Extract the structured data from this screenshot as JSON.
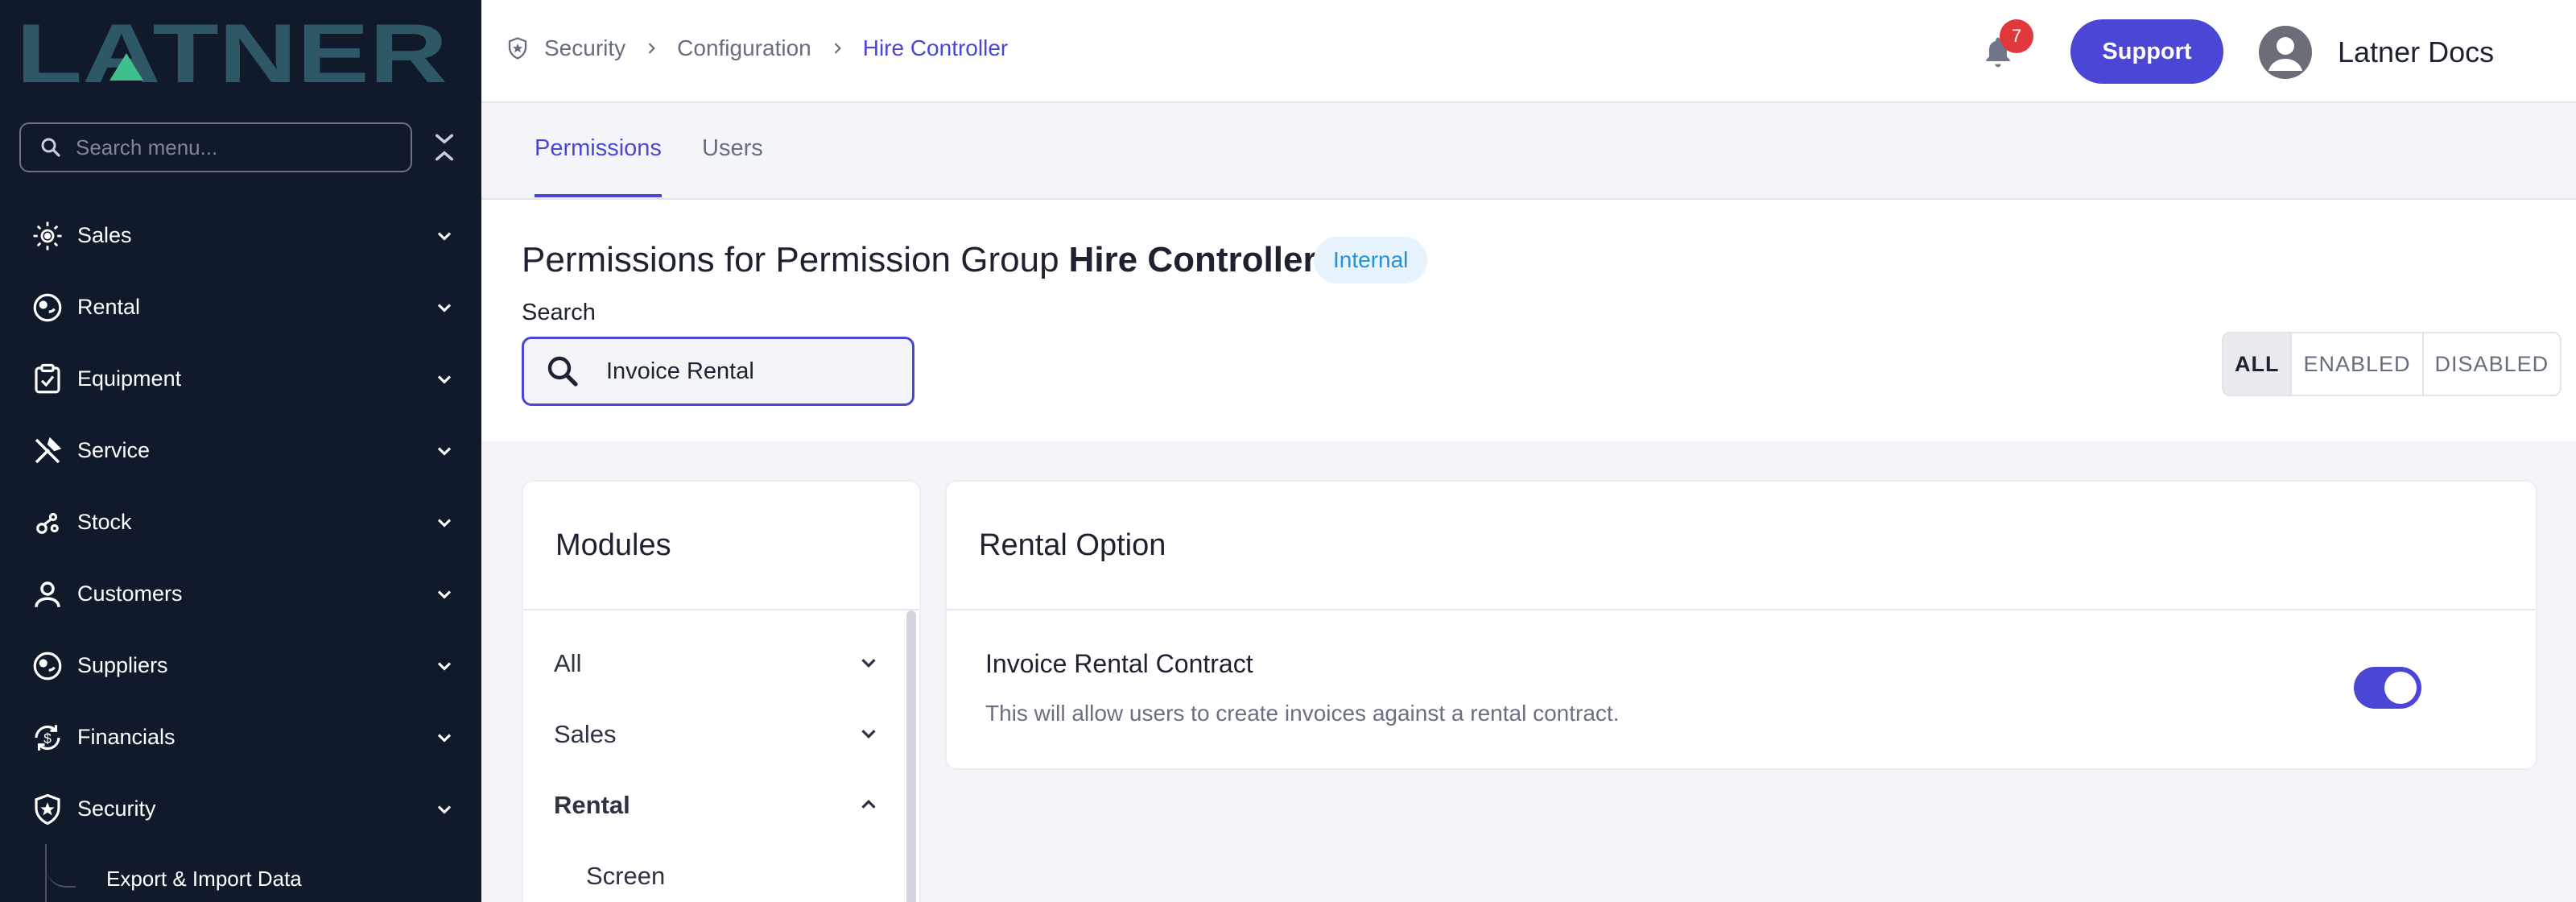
{
  "brand": {
    "logo_text": "LATNER",
    "logo_color": "#2f5866",
    "logo_accent": "#3fbf8c"
  },
  "sidebar": {
    "search_placeholder": "Search menu...",
    "items": [
      {
        "label": "Sales",
        "icon": "sales-icon"
      },
      {
        "label": "Rental",
        "icon": "rental-icon"
      },
      {
        "label": "Equipment",
        "icon": "clipboard-check-icon"
      },
      {
        "label": "Service",
        "icon": "tools-icon"
      },
      {
        "label": "Stock",
        "icon": "stock-icon"
      },
      {
        "label": "Customers",
        "icon": "user-icon"
      },
      {
        "label": "Suppliers",
        "icon": "suppliers-icon"
      },
      {
        "label": "Financials",
        "icon": "currency-cycle-icon"
      },
      {
        "label": "Security",
        "icon": "shield-star-icon"
      }
    ],
    "sub_item": "Export & Import Data"
  },
  "header": {
    "breadcrumb": [
      "Security",
      "Configuration",
      "Hire Controller"
    ],
    "notifications": "7",
    "support_label": "Support",
    "user_name": "Latner Docs"
  },
  "tabs": [
    {
      "label": "Permissions",
      "active": true
    },
    {
      "label": "Users",
      "active": false
    }
  ],
  "page": {
    "title_prefix": "Permissions for Permission Group",
    "title_group": "Hire Controller",
    "badge": "Internal",
    "search_label": "Search",
    "search_value": "Invoice Rental",
    "filters": [
      "ALL",
      "ENABLED",
      "DISABLED"
    ],
    "active_filter": "ALL"
  },
  "modules": {
    "title": "Modules",
    "items": [
      {
        "label": "All",
        "expanded": false
      },
      {
        "label": "Sales",
        "expanded": false
      },
      {
        "label": "Rental",
        "expanded": true
      }
    ],
    "sub_item": "Screen"
  },
  "option": {
    "title": "Rental Option",
    "permission_name": "Invoice Rental Contract",
    "permission_desc": "This will allow users to create invoices against a rental contract.",
    "enabled": true
  },
  "colors": {
    "accent": "#4b46d6",
    "sidebar": "#101a2b",
    "badge_bg": "#e6f2fc",
    "badge_text": "#2690d8",
    "notification": "#e0383d"
  }
}
